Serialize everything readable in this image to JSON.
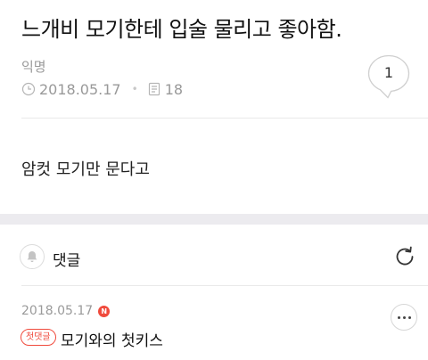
{
  "post": {
    "title": "느개비 모기한테 입술 물리고 좋아함.",
    "author": "익명",
    "date": "2018.05.17",
    "views": "18",
    "comment_count": "1",
    "body": "암컷 모기만 문다고"
  },
  "comments_section": {
    "label": "댓글",
    "icons": {
      "bell": "bell-icon",
      "refresh": "refresh-icon",
      "more": "more-icon"
    }
  },
  "comments": [
    {
      "date": "2018.05.17",
      "new_badge": "N",
      "first_badge": "첫댓글",
      "text": "모기와의 첫키스"
    }
  ],
  "colors": {
    "accent": "#f04a3c",
    "gap": "#ecebef",
    "muted": "#9a9a9a"
  }
}
